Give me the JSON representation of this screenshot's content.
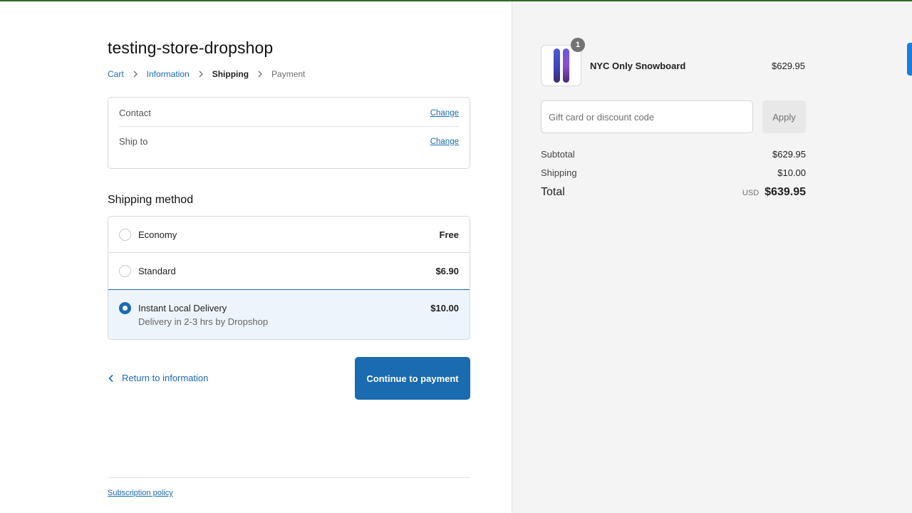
{
  "store": {
    "name": "testing-store-dropshop"
  },
  "breadcrumb": {
    "items": [
      {
        "label": "Cart",
        "state": "link"
      },
      {
        "label": "Information",
        "state": "link"
      },
      {
        "label": "Shipping",
        "state": "current"
      },
      {
        "label": "Payment",
        "state": "upcoming"
      }
    ]
  },
  "review": {
    "contact_label": "Contact",
    "ship_to_label": "Ship to",
    "change_label": "Change"
  },
  "shipping": {
    "title": "Shipping method",
    "methods": [
      {
        "name": "Economy",
        "price": "Free",
        "selected": false
      },
      {
        "name": "Standard",
        "price": "$6.90",
        "selected": false
      },
      {
        "name": "Instant Local Delivery",
        "subtitle": "Delivery in 2-3 hrs by Dropshop",
        "price": "$10.00",
        "selected": true
      }
    ]
  },
  "actions": {
    "return_label": "Return to information",
    "continue_label": "Continue to payment"
  },
  "footer": {
    "policy_label": "Subscription policy"
  },
  "summary": {
    "product": {
      "name": "NYC Only Snowboard",
      "price": "$629.95",
      "quantity": "1"
    },
    "discount": {
      "placeholder": "Gift card or discount code",
      "apply_label": "Apply"
    },
    "subtotal_label": "Subtotal",
    "subtotal_value": "$629.95",
    "shipping_label": "Shipping",
    "shipping_value": "$10.00",
    "total_label": "Total",
    "currency": "USD",
    "total_value": "$639.95"
  },
  "colors": {
    "accent": "#1a6bb0",
    "top_strip": "#2e6b2a",
    "summary_bg": "#f4f4f4"
  }
}
